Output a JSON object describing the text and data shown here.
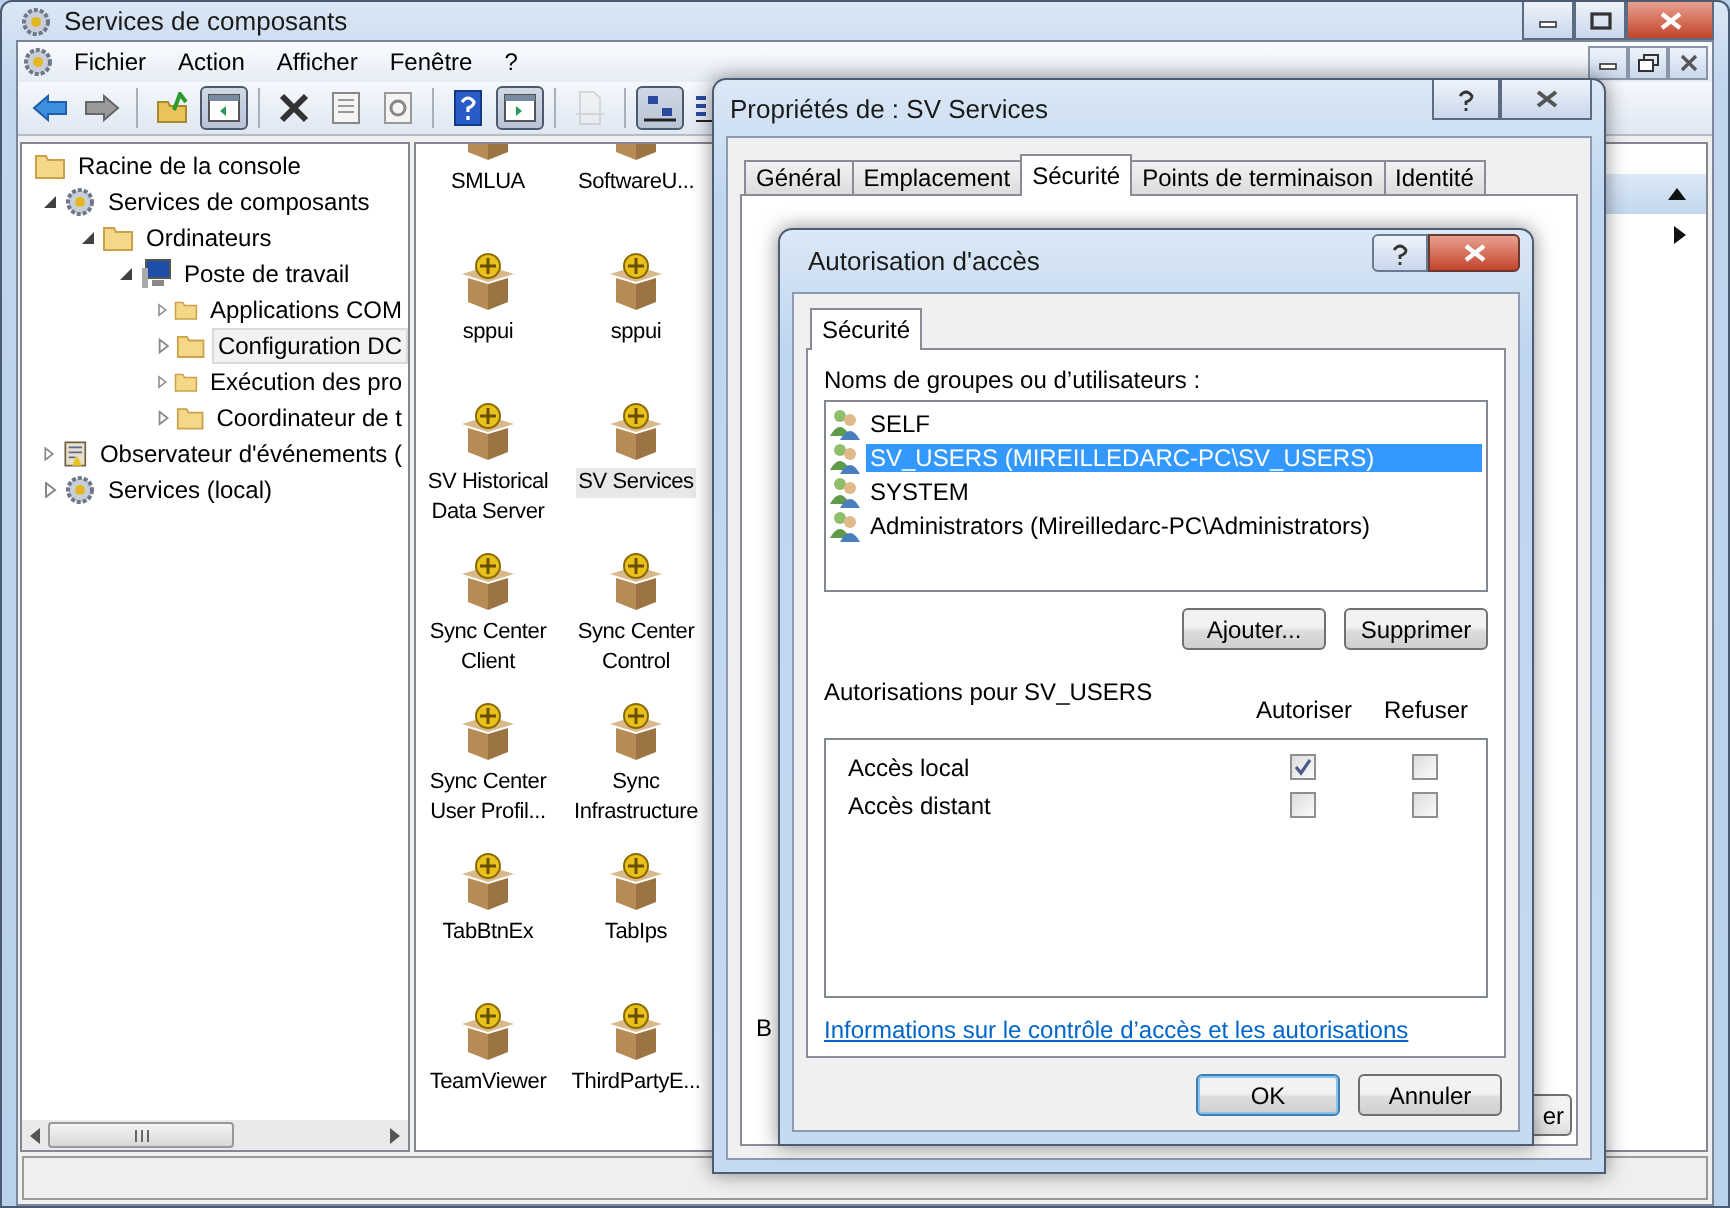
{
  "window": {
    "title": "Services de composants"
  },
  "menu": [
    "Fichier",
    "Action",
    "Afficher",
    "Fenêtre",
    "?"
  ],
  "toolbar": [
    [
      {
        "kind": "back",
        "pressed": false,
        "disabled": false
      },
      {
        "kind": "forward",
        "pressed": false,
        "disabled": false
      }
    ],
    [
      {
        "kind": "up",
        "pressed": false,
        "disabled": false
      },
      {
        "kind": "tree",
        "pressed": true,
        "disabled": false
      }
    ],
    [
      {
        "kind": "delete",
        "pressed": false,
        "disabled": false
      },
      {
        "kind": "properties",
        "pressed": false,
        "disabled": false
      },
      {
        "kind": "refresh",
        "pressed": false,
        "disabled": false
      }
    ],
    [
      {
        "kind": "help",
        "pressed": false,
        "disabled": false
      },
      {
        "kind": "pane",
        "pressed": true,
        "disabled": false
      }
    ],
    [
      {
        "kind": "export",
        "pressed": false,
        "disabled": true
      }
    ],
    [
      {
        "kind": "large",
        "pressed": true,
        "disabled": false
      },
      {
        "kind": "small",
        "pressed": false,
        "disabled": false
      }
    ]
  ],
  "tree": [
    {
      "label": "Racine de la console",
      "kind": "folder",
      "selected": false,
      "children": [
        {
          "label": "Services de composants",
          "kind": "gear",
          "expanded": true,
          "selected": false,
          "children": [
            {
              "label": "Ordinateurs",
              "kind": "folder",
              "expanded": true,
              "selected": false,
              "children": [
                {
                  "label": "Poste de travail",
                  "kind": "computer",
                  "expanded": true,
                  "selected": false,
                  "children": [
                    {
                      "label": "Applications COM",
                      "kind": "folder",
                      "expanded": false,
                      "selected": false
                    },
                    {
                      "label": "Configuration DC",
                      "kind": "folder",
                      "expanded": false,
                      "selected": true
                    },
                    {
                      "label": "Exécution des pro",
                      "kind": "folder",
                      "expanded": false,
                      "selected": false
                    },
                    {
                      "label": "Coordinateur de t",
                      "kind": "folder",
                      "expanded": false,
                      "selected": false
                    }
                  ]
                }
              ]
            }
          ]
        },
        {
          "label": "Observateur d'événements (",
          "kind": "log",
          "expanded": false,
          "selected": false
        },
        {
          "label": "Services (local)",
          "kind": "gear",
          "expanded": false,
          "selected": false
        }
      ]
    }
  ],
  "components": [
    {
      "label": "SMLUA",
      "selected": false
    },
    {
      "label": "SoftwareU...",
      "selected": false
    },
    {
      "label": "sppui",
      "selected": false
    },
    {
      "label": "sppui",
      "selected": false
    },
    {
      "label": "SV Historical Data Server",
      "selected": false
    },
    {
      "label": "SV Services",
      "selected": true
    },
    {
      "label": "Sync Center Client",
      "selected": false
    },
    {
      "label": "Sync Center Control",
      "selected": false
    },
    {
      "label": "Sync Center User Profil...",
      "selected": false
    },
    {
      "label": "Sync Infrastructure",
      "selected": false
    },
    {
      "label": "TabBtnEx",
      "selected": false
    },
    {
      "label": "TabIps",
      "selected": false
    },
    {
      "label": "TeamViewer",
      "selected": false
    },
    {
      "label": "ThirdPartyE...",
      "selected": false
    }
  ],
  "properties": {
    "title": "Propriétés de : SV Services",
    "tabs": [
      {
        "label": "Général",
        "selected": false
      },
      {
        "label": "Emplacement",
        "selected": false
      },
      {
        "label": "Sécurité",
        "selected": true
      },
      {
        "label": "Points de terminaison",
        "selected": false
      },
      {
        "label": "Identité",
        "selected": false
      }
    ],
    "text_fragment": "B",
    "button_fragment": "er"
  },
  "access": {
    "title": "Autorisation d'accès",
    "tab": "Sécurité",
    "users_label": "Noms de groupes ou d’utilisateurs :",
    "users": [
      {
        "name": "SELF",
        "selected": false
      },
      {
        "name": "SV_USERS (MIREILLEDARC-PC\\SV_USERS)",
        "selected": true
      },
      {
        "name": "SYSTEM",
        "selected": false
      },
      {
        "name": "Administrators (Mireilledarc-PC\\Administrators)",
        "selected": false
      }
    ],
    "add_button": "Ajouter...",
    "remove_button": "Supprimer",
    "permissions_label": "Autorisations pour SV_USERS",
    "columns": [
      "Autoriser",
      "Refuser"
    ],
    "permissions": [
      {
        "name": "Accès local",
        "allow": true,
        "deny": false
      },
      {
        "name": "Accès distant",
        "allow": false,
        "deny": false
      }
    ],
    "link": "Informations sur le contrôle d’accès et les autorisations",
    "ok": "OK",
    "cancel": "Annuler"
  }
}
